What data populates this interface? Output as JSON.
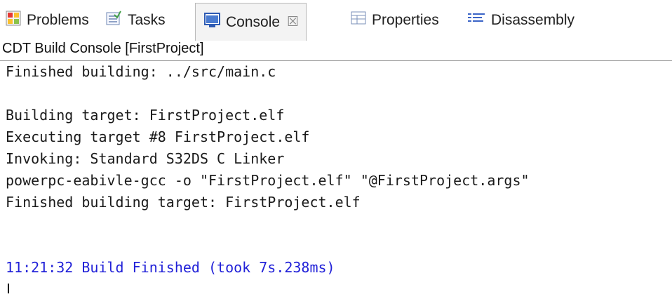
{
  "tabs": [
    {
      "label": "Problems",
      "icon": "problems-icon"
    },
    {
      "label": "Tasks",
      "icon": "tasks-icon"
    },
    {
      "label": "Console",
      "icon": "console-icon",
      "active": true,
      "close": "☒"
    },
    {
      "label": "Properties",
      "icon": "properties-icon"
    },
    {
      "label": "Disassembly",
      "icon": "disassembly-icon"
    }
  ],
  "console": {
    "title": "CDT Build Console [FirstProject]",
    "lines": [
      "Finished building: ../src/main.c",
      "",
      "Building target: FirstProject.elf",
      "Executing target #8 FirstProject.elf",
      "Invoking: Standard S32DS C Linker",
      "powerpc-eabivle-gcc -o \"FirstProject.elf\" \"@FirstProject.args\"",
      "Finished building target: FirstProject.elf",
      "",
      "",
      "11:21:32 Build Finished (took 7s.238ms)"
    ]
  },
  "colors": {
    "status_text": "#2121d8",
    "normal_text": "#1a1a1a"
  }
}
